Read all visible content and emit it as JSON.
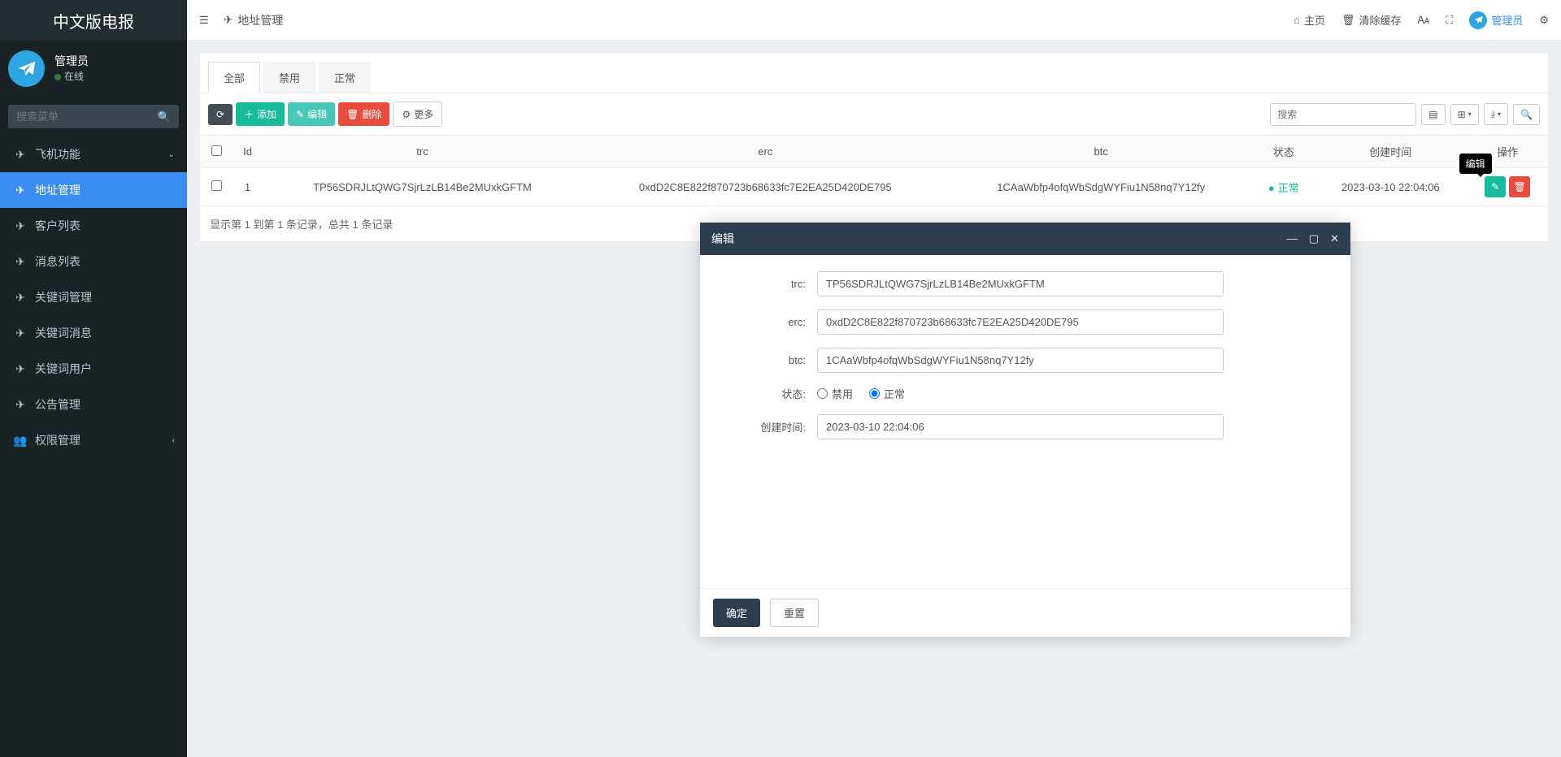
{
  "brand": "中文版电报",
  "user": {
    "name": "管理员",
    "status": "在线"
  },
  "search_placeholder": "搜索菜单",
  "sidebar": {
    "groups": [
      {
        "label": "飞机功能",
        "icon": "send"
      },
      {
        "label": "权限管理",
        "icon": "users"
      }
    ],
    "items": [
      {
        "label": "地址管理"
      },
      {
        "label": "客户列表"
      },
      {
        "label": "消息列表"
      },
      {
        "label": "关键词管理"
      },
      {
        "label": "关键词消息"
      },
      {
        "label": "关键词用户"
      },
      {
        "label": "公告管理"
      }
    ]
  },
  "topbar": {
    "breadcrumb": "地址管理",
    "home": "主页",
    "clear_cache": "清除缓存",
    "admin": "管理员"
  },
  "tabs": [
    "全部",
    "禁用",
    "正常"
  ],
  "toolbar": {
    "refresh": "",
    "add": "添加",
    "edit": "编辑",
    "delete": "删除",
    "more": "更多",
    "search_placeholder": "搜索"
  },
  "table": {
    "headers": [
      "",
      "Id",
      "trc",
      "erc",
      "btc",
      "状态",
      "创建时间",
      "操作"
    ],
    "rows": [
      {
        "id": "1",
        "trc": "TP56SDRJLtQWG7SjrLzLB14Be2MUxkGFTM",
        "erc": "0xdD2C8E822f870723b68633fc7E2EA25D420DE795",
        "btc": "1CAaWbfp4ofqWbSdgWYFiu1N58nq7Y12fy",
        "status": "正常",
        "created": "2023-03-10 22:04:06"
      }
    ],
    "summary": "显示第 1 到第 1 条记录，总共 1 条记录"
  },
  "tooltip_edit": "编辑",
  "modal": {
    "title": "编辑",
    "labels": {
      "trc": "trc:",
      "erc": "erc:",
      "btc": "btc:",
      "status": "状态:",
      "created": "创建时间:"
    },
    "values": {
      "trc": "TP56SDRJLtQWG7SjrLzLB14Be2MUxkGFTM",
      "erc": "0xdD2C8E822f870723b68633fc7E2EA25D420DE795",
      "btc": "1CAaWbfp4ofqWbSdgWYFiu1N58nq7Y12fy",
      "created": "2023-03-10 22:04:06"
    },
    "radio_disabled": "禁用",
    "radio_normal": "正常",
    "ok": "确定",
    "reset": "重置"
  }
}
